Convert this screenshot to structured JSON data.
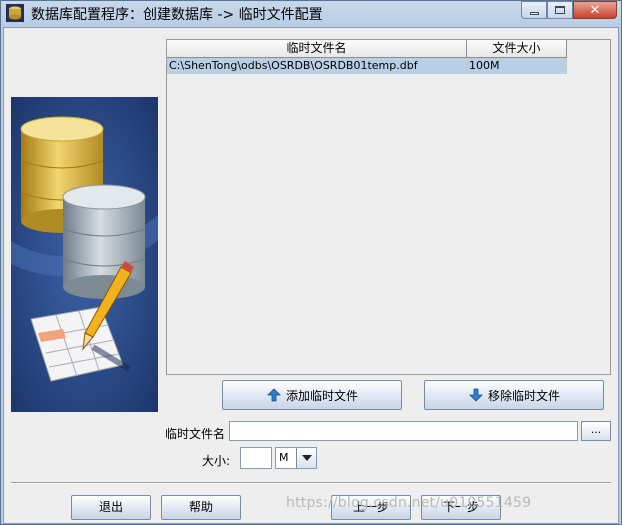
{
  "window": {
    "title": "数据库配置程序：创建数据库 -> 临时文件配置",
    "controls": {
      "minimize": "minimize",
      "maximize": "maximize",
      "close": "✕"
    }
  },
  "table": {
    "columns": [
      "临时文件名",
      "文件大小"
    ],
    "rows": [
      {
        "name": "C:\\ShenTong\\odbs\\OSRDB\\OSRDB01temp.dbf",
        "size": "100M"
      }
    ],
    "selected_row_color": "#b8cfe5"
  },
  "buttons": {
    "add_temp_file": "添加临时文件",
    "remove_temp_file": "移除临时文件",
    "browse": "...",
    "exit": "退出",
    "help": "帮助",
    "prev": "上一步",
    "next": "下一步"
  },
  "form": {
    "temp_file_name_label": "临时文件名",
    "temp_file_name_value": "",
    "size_label": "大小:",
    "size_value": "",
    "unit_value": "M"
  },
  "watermark": "https://blog.csdn.net/u010551459",
  "colors": {
    "titlebar": "#c9d9ec",
    "client_bg": "#eeeeee",
    "close_button": "#c7412a"
  }
}
